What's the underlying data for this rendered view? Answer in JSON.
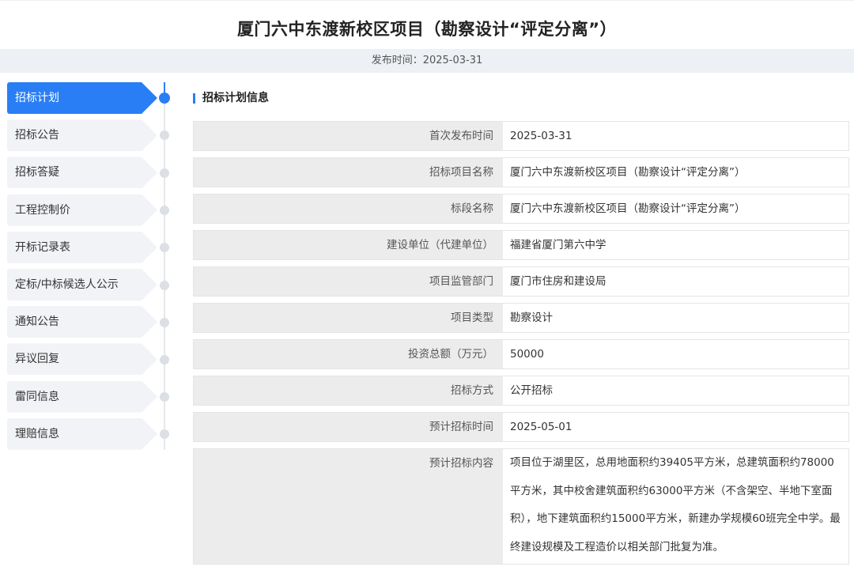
{
  "header": {
    "title": "厦门六中东渡新校区项目（勘察设计“评定分离”）",
    "publish_label": "发布时间：",
    "publish_date": "2025-03-31"
  },
  "sidebar": {
    "items": [
      {
        "label": "招标计划",
        "active": true
      },
      {
        "label": "招标公告",
        "active": false
      },
      {
        "label": "招标答疑",
        "active": false
      },
      {
        "label": "工程控制价",
        "active": false
      },
      {
        "label": "开标记录表",
        "active": false
      },
      {
        "label": "定标/中标候选人公示",
        "active": false
      },
      {
        "label": "通知公告",
        "active": false
      },
      {
        "label": "异议回复",
        "active": false
      },
      {
        "label": "雷同信息",
        "active": false
      },
      {
        "label": "理赔信息",
        "active": false
      }
    ]
  },
  "section": {
    "title": "招标计划信息"
  },
  "info": {
    "rows": [
      {
        "key": "首次发布时间",
        "value": "2025-03-31"
      },
      {
        "key": "招标项目名称",
        "value": "厦门六中东渡新校区项目（勘察设计“评定分离”）"
      },
      {
        "key": "标段名称",
        "value": "厦门六中东渡新校区项目（勘察设计“评定分离”）"
      },
      {
        "key": "建设单位（代建单位）",
        "value": "福建省厦门第六中学"
      },
      {
        "key": "项目监管部门",
        "value": "厦门市住房和建设局"
      },
      {
        "key": "项目类型",
        "value": "勘察设计"
      },
      {
        "key": "投资总额（万元）",
        "value": "50000"
      },
      {
        "key": "招标方式",
        "value": "公开招标"
      },
      {
        "key": "预计招标时间",
        "value": "2025-05-01"
      }
    ],
    "content": {
      "key": "预计招标内容",
      "value": "项目位于湖里区，总用地面积约39405平方米，总建筑面积约78000平方米，其中校舍建筑面积约63000平方米（不含架空、半地下室面积），地下建筑面积约15000平方米，新建办学规模60班完全中学。最终建设规模及工程造价以相关部门批复为准。"
    }
  },
  "colors": {
    "accent": "#2a7ef5",
    "nav_bg": "#f1f3f6",
    "key_bg": "#ececec"
  }
}
